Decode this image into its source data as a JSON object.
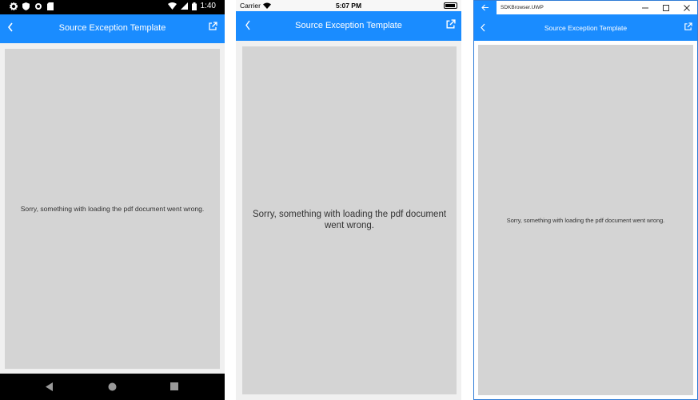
{
  "colors": {
    "accent": "#1a8cff",
    "content_bg": "#d4d4d4",
    "page_bg": "#f0f0f0"
  },
  "android": {
    "status": {
      "time": "1:40",
      "icons": [
        "gear-icon",
        "shield-icon",
        "circle-icon",
        "sd-card-icon",
        "wifi-icon",
        "signal-icon",
        "battery-icon"
      ]
    },
    "title": "Source Exception Template",
    "message": "Sorry, something with loading the pdf document went wrong.",
    "nav_icons": [
      "back-triangle-icon",
      "home-circle-icon",
      "recents-square-icon"
    ]
  },
  "ios": {
    "status": {
      "carrier": "Carrier",
      "time": "5:07 PM"
    },
    "title": "Source Exception Template",
    "message": "Sorry, something with loading the pdf document went wrong."
  },
  "uwp": {
    "app_title": "SDKBrowser.UWP",
    "title": "Source Exception Template",
    "message": "Sorry, something with loading the pdf document went wrong."
  }
}
